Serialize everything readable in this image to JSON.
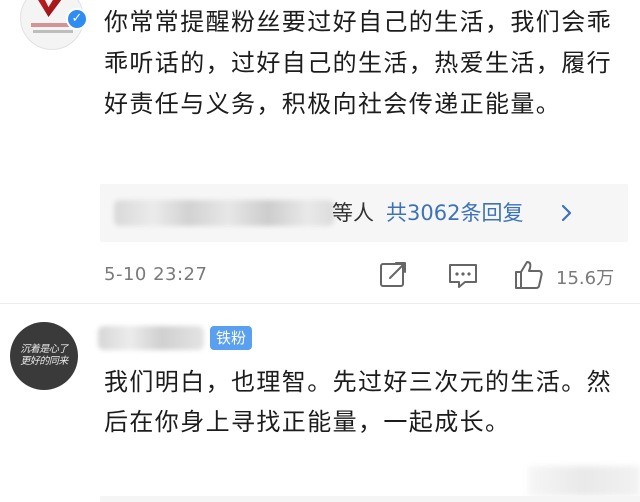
{
  "post": {
    "text": "你常常提醒粉丝要过好自己的生活，我们会乖乖听话的，过好自己的生活，热爱生活，履行好责任与义务，积极向社会传递正能量。",
    "reply_preview": {
      "names_suffix": "等人",
      "count_label": "共3062条回复"
    },
    "timestamp": "5-10 23:27",
    "likes": "15.6万"
  },
  "comment": {
    "badge": "铁粉",
    "text": "我们明白，也理智。先过好三次元的生活。然后在你身上寻找正能量，一起成长。",
    "avatar_text": "沉着是心了 更好的同来"
  },
  "icons": {
    "verified": "verified-icon",
    "chevron": "chevron-right-icon",
    "share": "share-icon",
    "comment": "comment-icon",
    "like": "like-icon"
  },
  "colors": {
    "link_blue": "#3c72b8",
    "badge_blue": "#5aa0f0",
    "verified_blue": "#2f8cf0",
    "meta_gray": "#7a7a7a"
  }
}
